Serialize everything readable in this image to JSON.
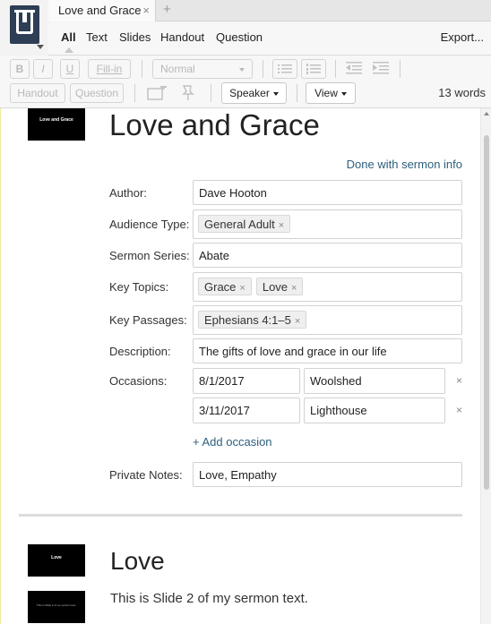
{
  "app": {
    "logo_icon": "app-logo-icon"
  },
  "tabs": {
    "active_title": "Love and Grace",
    "close_glyph": "×",
    "new_glyph": "+"
  },
  "modes": {
    "all": "All",
    "text": "Text",
    "slides": "Slides",
    "handout": "Handout",
    "question": "Question",
    "export": "Export..."
  },
  "toolbar": {
    "bold": "B",
    "italic": "I",
    "underline": "U",
    "fill_in": "Fill-in",
    "style_select": "Normal",
    "handout": "Handout",
    "question": "Question",
    "speaker": "Speaker",
    "view": "View",
    "word_count": "13 words"
  },
  "sermon": {
    "title": "Love and Grace",
    "slide_thumb_title": "Love and Grace",
    "done_link": "Done with sermon info",
    "labels": {
      "author": "Author:",
      "audience": "Audience Type:",
      "series": "Sermon Series:",
      "topics": "Key Topics:",
      "passages": "Key Passages:",
      "description": "Description:",
      "occasions": "Occasions:",
      "notes": "Private Notes:"
    },
    "author": "Dave Hooton",
    "audience": [
      "General Adult"
    ],
    "series": "Abate",
    "topics": [
      "Grace",
      "Love"
    ],
    "passages": [
      "Ephesians 4:1–5"
    ],
    "description": "The gifts of love and grace  in our life",
    "occasions": [
      {
        "date": "8/1/2017",
        "place": "Woolshed"
      },
      {
        "date": "3/11/2017",
        "place": "Lighthouse"
      }
    ],
    "add_occasion": "+ Add occasion",
    "notes": "Love, Empathy",
    "chip_remove": "×"
  },
  "section": {
    "heading": "Love",
    "thumb_title": "Love",
    "thumb2_text": "This is Slide 2 of my sermon text.",
    "body": "This is Slide 2 of my sermon text."
  }
}
